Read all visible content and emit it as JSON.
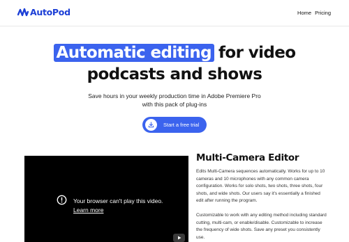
{
  "brand": {
    "name": "AutoPod",
    "color": "#1c3fd6",
    "icon": "waveform-logo-icon"
  },
  "nav": {
    "home": "Home",
    "pricing": "Pricing"
  },
  "hero": {
    "highlight": "Automatic editing",
    "rest": "for video",
    "line2": "podcasts and shows",
    "accent": "#3b63ee"
  },
  "subtitle": {
    "line1": "Save hours in your weekly production time in Adobe Premiere Pro",
    "line2": "with this pack of plug-ins"
  },
  "cta": {
    "label": "Start a free trial",
    "icon": "download-icon"
  },
  "video": {
    "message": "Your browser can't play this video.",
    "link": "Learn more",
    "icons": [
      "info-icon",
      "youtube-icon"
    ]
  },
  "feature": {
    "title": "Multi-Camera Editor",
    "p1": "Edits Multi-Camera sequences automatically.  Works for up to 10 cameras and 10 microphones with any common camera configuration. Works for solo shots, two shots, three shots, four shots, and wide shots. Our users say it's essentially a finished edit after running the program.",
    "p2": "Customizable to work with any editing method including standard cutting, multi-cam, or enable/disable.  Customizable to increase the frequency of wide shots.  Save any preset you consistently use."
  }
}
